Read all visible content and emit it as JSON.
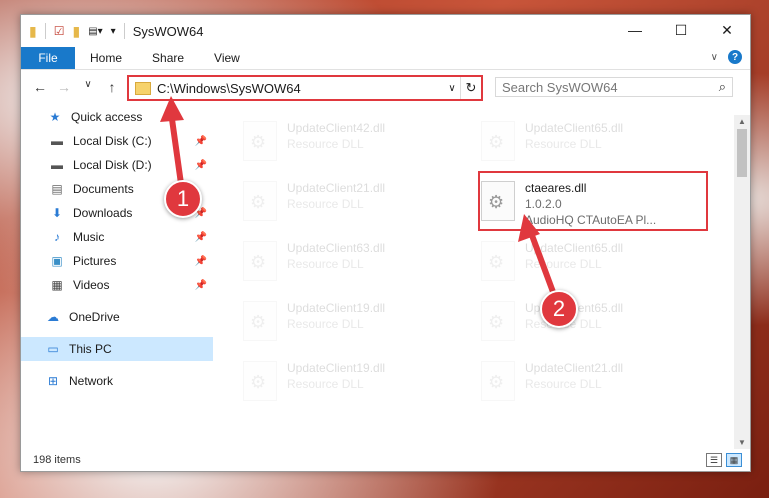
{
  "window": {
    "title": "SysWOW64"
  },
  "ribbon": {
    "file": "File",
    "tabs": [
      "Home",
      "Share",
      "View"
    ]
  },
  "address": {
    "path": "C:\\Windows\\SysWOW64"
  },
  "search": {
    "placeholder": "Search SysWOW64"
  },
  "sidebar": {
    "items": [
      {
        "label": "Quick access",
        "icon": "star-icon"
      },
      {
        "label": "Local Disk (C:)",
        "icon": "drive-icon"
      },
      {
        "label": "Local Disk (D:)",
        "icon": "drive-icon"
      },
      {
        "label": "Documents",
        "icon": "documents-icon"
      },
      {
        "label": "Downloads",
        "icon": "download-icon"
      },
      {
        "label": "Music",
        "icon": "music-icon"
      },
      {
        "label": "Pictures",
        "icon": "pictures-icon"
      },
      {
        "label": "Videos",
        "icon": "videos-icon"
      },
      {
        "label": "OneDrive",
        "icon": "cloud-icon"
      },
      {
        "label": "This PC",
        "icon": "computer-icon"
      },
      {
        "label": "Network",
        "icon": "network-icon"
      }
    ]
  },
  "files": [
    {
      "name": "UpdateClient42.dll",
      "meta": "Resource DLL"
    },
    {
      "name": "UpdateClient65.dll",
      "meta": "Resource DLL"
    },
    {
      "name": "UpdateClient21.dll",
      "meta": "Resource DLL"
    },
    {
      "name": "ctaeares.dll",
      "version": "1.0.2.0",
      "desc": "AudioHQ CTAutoEA Pl..."
    },
    {
      "name": "UpdateClient63.dll",
      "meta": "Resource DLL"
    },
    {
      "name": "UpdateClient65.dll",
      "meta": "Resource DLL"
    },
    {
      "name": "UpdateClient19.dll",
      "meta": "Resource DLL"
    },
    {
      "name": "UpdateClient65.dll",
      "meta": "Resource DLL"
    },
    {
      "name": "UpdateClient19.dll",
      "meta": "Resource DLL"
    },
    {
      "name": "UpdateClient21.dll",
      "meta": "Resource DLL"
    }
  ],
  "status": {
    "count": "198 items"
  },
  "annotations": {
    "step1": "1",
    "step2": "2"
  },
  "colors": {
    "accent": "#1979ca",
    "highlight": "#e0383e",
    "selected": "#cce8ff"
  }
}
